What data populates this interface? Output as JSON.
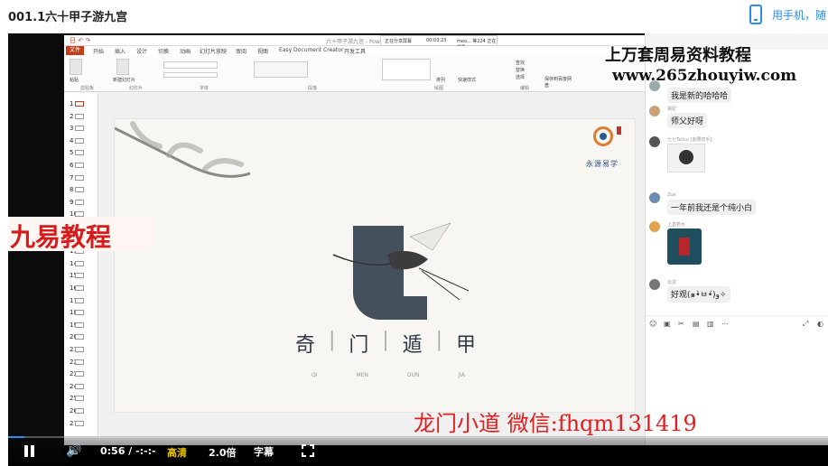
{
  "page": {
    "title": "001.1六十甲子游九宫",
    "mobile_label": "用手机，随"
  },
  "ppt": {
    "quick_access": "日 ↶ ↷",
    "file_name": "六十甲子游九宫 - PowerPoint",
    "tabs": [
      "文件",
      "开始",
      "插入",
      "设计",
      "切换",
      "动画",
      "幻灯片放映",
      "审阅",
      "视图",
      "Easy Document Creator",
      "开发工具"
    ],
    "share_bar": {
      "status": "正在分享屏幕",
      "time": "00:03:23",
      "user": "meo... 等224 正在观看"
    },
    "ribbon_groups": [
      "剪贴板",
      "幻灯片",
      "字体",
      "段落",
      "绘图",
      "编辑"
    ],
    "ribbon_buttons": [
      "粘贴",
      "新建幻灯片",
      "排列",
      "快速样式",
      "查找",
      "替换",
      "选择",
      "保存到百度网盘"
    ],
    "slide_numbers": [
      "1",
      "2",
      "3",
      "4",
      "5",
      "6",
      "7",
      "8",
      "9",
      "10",
      "11",
      "12",
      "13",
      "14",
      "15",
      "16",
      "17",
      "18",
      "19",
      "20",
      "21",
      "22",
      "23",
      "24",
      "25",
      "26",
      "27"
    ],
    "slide": {
      "brand": "永源易学",
      "title_chars": [
        "奇",
        "门",
        "遁",
        "甲"
      ],
      "pinyin": [
        "QI",
        "MEN",
        "DUN",
        "JIA"
      ]
    }
  },
  "chat": {
    "messages": [
      {
        "user": "",
        "text": "我是新的哈哈哈"
      },
      {
        "user": "骆驼",
        "text": "师父好呀"
      },
      {
        "user": "七七Tallsu [金腰双手]",
        "sticker": "panda-sticker"
      },
      {
        "user": "Zoe",
        "text": "一年前我还是个纯小白"
      },
      {
        "user": "上善若水",
        "sticker": "red-packet"
      },
      {
        "user": "云逆",
        "text": "好观(๑•̀ㅂ•́)و✧"
      }
    ],
    "tools": [
      "☺",
      "▣",
      "✂",
      "▤",
      "▥",
      "⋯",
      "⤢",
      "◐"
    ]
  },
  "watermarks": {
    "top_line1": "上万套周易资料教程",
    "top_line2": "www.265zhouyiw.com",
    "left": "九易教程",
    "bottom": "龙门小道 微信:fhqm131419"
  },
  "player": {
    "current_time": "0:56",
    "separator": "/",
    "duration": "-:-:-",
    "quality": "高清",
    "speed": "2.0倍",
    "subtitles": "字幕",
    "progress": 0.02,
    "accent": "#2a8cf0"
  }
}
